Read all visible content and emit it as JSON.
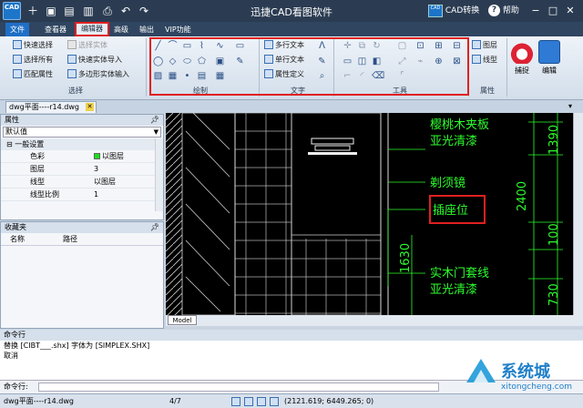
{
  "window": {
    "title": "迅捷CAD看图软件",
    "logo_text": "CAD",
    "cad_convert_label": "CAD转换",
    "help_label": "帮助"
  },
  "tabs": [
    {
      "label": "文件"
    },
    {
      "label": "查看器"
    },
    {
      "label": "编辑器"
    },
    {
      "label": "高级"
    },
    {
      "label": "输出"
    },
    {
      "label": "VIP功能"
    }
  ],
  "ribbon": {
    "select_group": {
      "label": "选择",
      "items": [
        "快速选择",
        "选择所有",
        "匹配属性",
        "选择实体",
        "快速实体导入",
        "多边形实体输入"
      ]
    },
    "draw_group": {
      "label": "绘制"
    },
    "text_group": {
      "label": "文字",
      "items": [
        "多行文本",
        "单行文本",
        "属性定义"
      ]
    },
    "tools_group": {
      "label": "工具"
    },
    "props_group": {
      "label": "属性",
      "items": [
        "图层",
        "线型"
      ]
    },
    "snap_label": "捕捉",
    "edit_label": "编辑"
  },
  "doc_tab": {
    "label": "dwg平面----r14.dwg"
  },
  "properties": {
    "title": "属性",
    "selector_value": "默认值",
    "section": "一般设置",
    "rows": [
      {
        "key": "色彩",
        "value": "以图层"
      },
      {
        "key": "图层",
        "value": "3"
      },
      {
        "key": "线型",
        "value": "以图层"
      },
      {
        "key": "线型比例",
        "value": "1"
      }
    ]
  },
  "favorites": {
    "title": "收藏夹",
    "columns": [
      "名称",
      "路径"
    ]
  },
  "drawing": {
    "labels": [
      "樱桃木夹板",
      "亚光清漆",
      "剃须镜",
      "插座位",
      "实木门套线",
      "亚光清漆"
    ],
    "dimensions": [
      "1390",
      "2400",
      "100",
      "1630",
      "730"
    ],
    "model_tab": "Model"
  },
  "command": {
    "title": "命令行",
    "log": [
      "替换 [CIBT___.shx] 字体为 [SIMPLEX.SHX]",
      "取消"
    ],
    "input_label": "命令行:"
  },
  "status": {
    "file": "dwg平面----r14.dwg",
    "page": "4/7",
    "coords": "(2121.619; 6449.265; 0)"
  },
  "watermark": {
    "main": "系统城",
    "sub": "xitongcheng.com"
  },
  "colors": {
    "accent": "#1f6fc6",
    "highlight": "#e02020",
    "cad_green": "#2dfc2d",
    "titlebar": "#2b3c52"
  }
}
